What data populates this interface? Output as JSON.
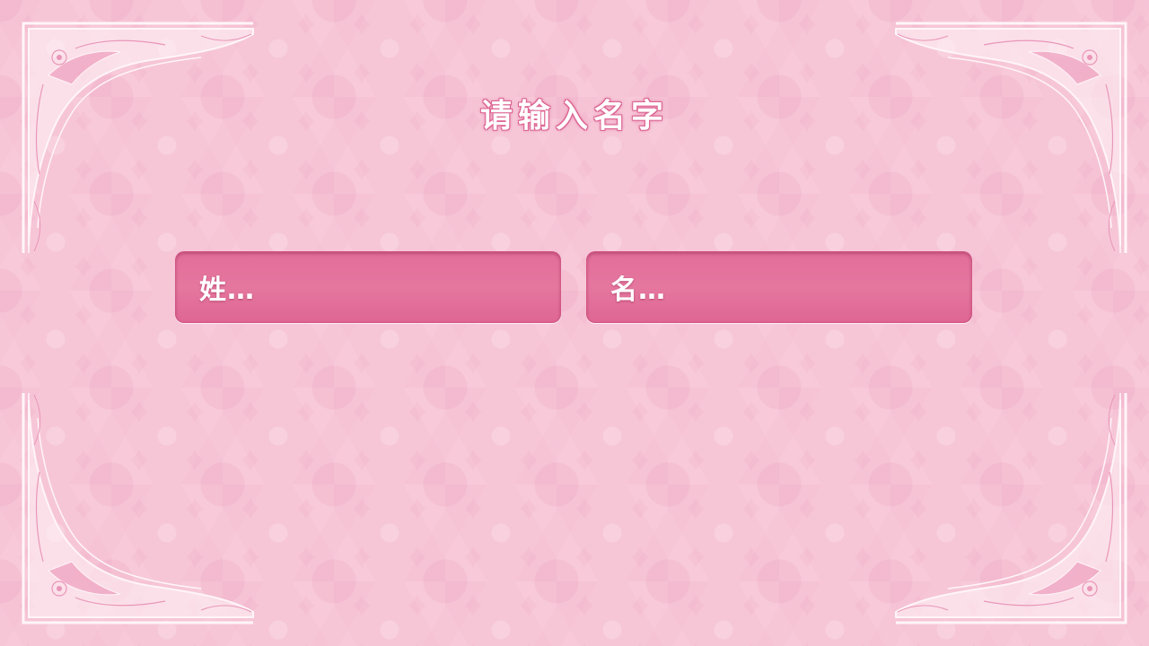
{
  "title": "请输入名字",
  "fields": {
    "surname": {
      "placeholder": "姓…"
    },
    "given_name": {
      "placeholder": "名…"
    }
  },
  "colors": {
    "background": "#f5bfd2",
    "field": "#e26d98",
    "text": "#ffffff",
    "frame": "#fff5f8"
  },
  "decorations": {
    "frame_corner_icon": "lace-frame-corner-icon"
  }
}
